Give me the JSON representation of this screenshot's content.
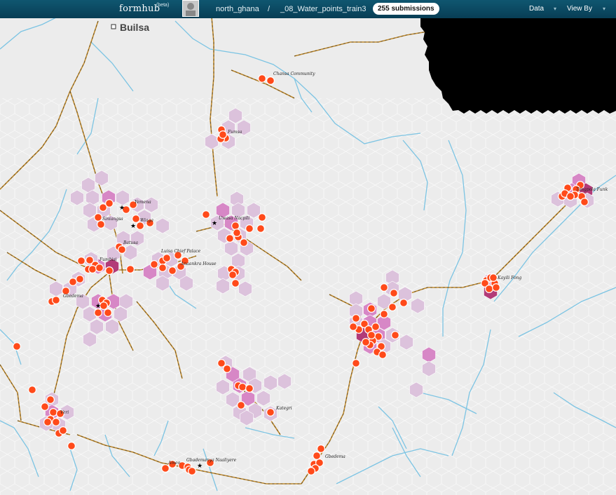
{
  "header": {
    "brand": "formhub",
    "beta": "(beta)",
    "crumbs": [
      "north_ghana",
      "/",
      "_08_Water_points_train3"
    ],
    "submissions": "255 submissions",
    "menus": [
      "Data",
      "View By"
    ]
  },
  "map": {
    "region_label": "Builsa",
    "place_labels": [
      "Chansa Community",
      "Fumsa",
      "Tangpola Funk",
      "Yemena",
      "Siniangsa",
      "Wiaga",
      "Uwasa Nacpili",
      "Batusa",
      "Luisa Chief Palace",
      "Anaankra House",
      "Fumbisi",
      "Gbedema",
      "Kayili Fong",
      "Kategri",
      "Ameo",
      "Gbademanya Naaliyere",
      "Veri",
      "Gbedema"
    ],
    "colors": {
      "water": "#7cc4e3",
      "road_main": "#c28b2c",
      "road_dash": "#5b4a2a",
      "point": "#ff4a1a",
      "hex_light": "#dcc2dc",
      "hex_mid": "#d787c6",
      "hex_dark": "#b23b78",
      "land": "#ececec",
      "header": "#0a4a62"
    },
    "icons": [
      "star-icon",
      "square-icon",
      "avatar-icon",
      "caret-down-icon"
    ]
  }
}
